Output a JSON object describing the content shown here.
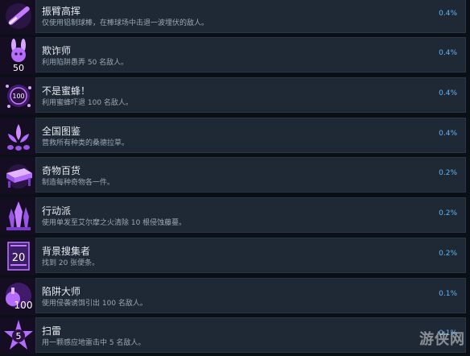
{
  "achievements": [
    {
      "title": "振臂高挥",
      "description": "仅使用铝制球棒，在棒球场中击退一波埋伏的敌人。",
      "percent": "0.4%",
      "icon": "baseball-bat-icon",
      "icon_text": ""
    },
    {
      "title": "欺诈师",
      "description": "利用陷阱愚弄 50 名敌人。",
      "percent": "0.4%",
      "icon": "bunny-mask-icon",
      "icon_text": "50"
    },
    {
      "title": "不是蜜蜂！",
      "description": "利用蜜蜂吓退 100 名敌人。",
      "percent": "0.4%",
      "icon": "bee-swarm-icon",
      "icon_text": "100"
    },
    {
      "title": "全国图鉴",
      "description": "营救所有种类的桑德拉草。",
      "percent": "0.4%",
      "icon": "sundra-plant-icon",
      "icon_text": ""
    },
    {
      "title": "奇物百货",
      "description": "制造每种奇物各一件。",
      "percent": "0.2%",
      "icon": "workbench-icon",
      "icon_text": ""
    },
    {
      "title": "行动派",
      "description": "使用单发至艾尔摩之火清除 10 根侵蚀藤蔓。",
      "percent": "0.2%",
      "icon": "crystal-flame-icon",
      "icon_text": ""
    },
    {
      "title": "背景搜集者",
      "description": "找到 20 张便条。",
      "percent": "0.2%",
      "icon": "note-icon",
      "icon_text": "20"
    },
    {
      "title": "陷阱大师",
      "description": "使用侵袭诱饵引出 100 名敌人。",
      "percent": "0.1%",
      "icon": "decoy-icon",
      "icon_text": "100"
    },
    {
      "title": "扫雷",
      "description": "用一颗感应地雷击中 5 名敌人。",
      "percent": "0.1%",
      "icon": "mine-icon",
      "icon_text": "5"
    }
  ],
  "watermark": "游侠网",
  "colors": {
    "background": "#0b1017",
    "panel": "#1f2936",
    "percent": "#62b4f5",
    "icon_purple": "#a34bff"
  }
}
